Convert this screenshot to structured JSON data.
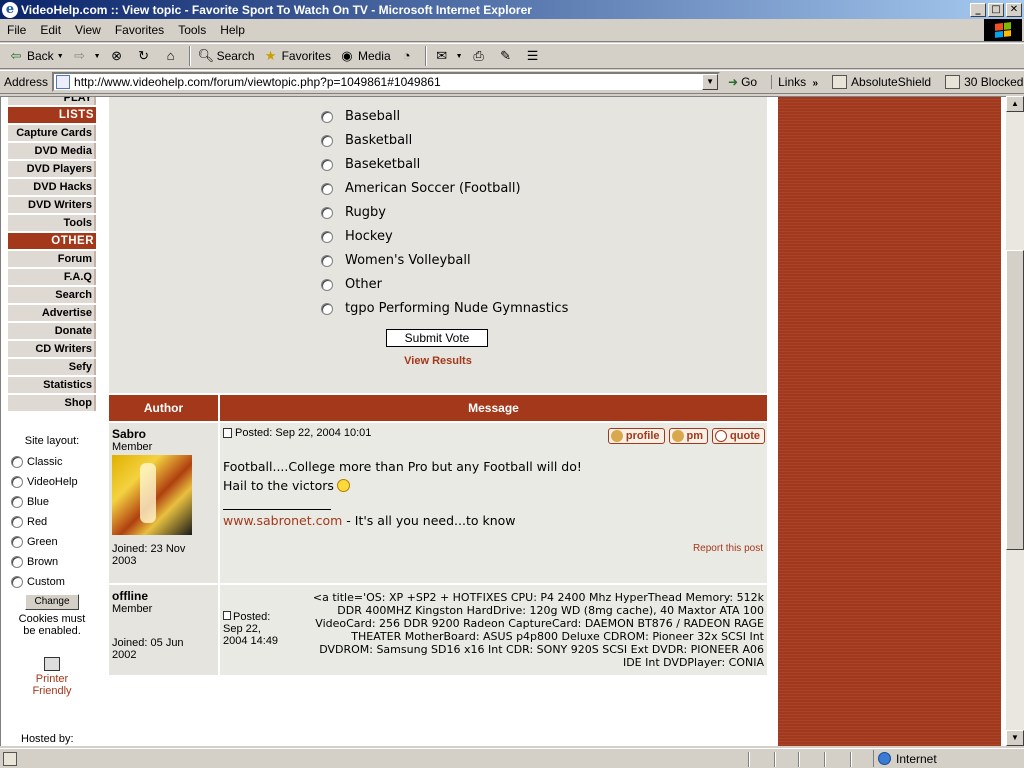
{
  "window": {
    "title": "VideoHelp.com :: View topic - Favorite Sport To Watch On TV - Microsoft Internet Explorer",
    "icon": "ie-icon",
    "buttons": [
      "_",
      "□",
      "✕"
    ]
  },
  "menu": [
    "File",
    "Edit",
    "View",
    "Favorites",
    "Tools",
    "Help"
  ],
  "toolbar": {
    "back": "Back",
    "search": "Search",
    "favorites": "Favorites",
    "media": "Media"
  },
  "address": {
    "label": "Address",
    "url": "http://www.videohelp.com/forum/viewtopic.php?p=1049861#1049861",
    "go": "Go",
    "links": "Links",
    "links_ext": "»",
    "shield": "AbsoluteShield",
    "blocked": "30 Blocked"
  },
  "nav": {
    "first": "PLAY",
    "lists_head": "LISTS",
    "lists": [
      "Capture Cards",
      "DVD Media",
      "DVD Players",
      "DVD Hacks",
      "DVD Writers",
      "Tools"
    ],
    "other_head": "OTHER",
    "other": [
      "Forum",
      "F.A.Q",
      "Search",
      "Advertise",
      "Donate",
      "CD Writers",
      "Sefy",
      "Statistics",
      "Shop"
    ]
  },
  "layout_switch": {
    "label": "Site layout:",
    "options": [
      "Classic",
      "VideoHelp",
      "Blue",
      "Red",
      "Green",
      "Brown",
      "Custom"
    ],
    "change_button": "Change",
    "cookies_line1": "Cookies must",
    "cookies_line2": "be enabled."
  },
  "printer": {
    "line1": "Printer",
    "line2": "Friendly"
  },
  "hosted_by": "Hosted by:",
  "poll": {
    "options": [
      "Baseball",
      "Basketball",
      "Baseketball",
      "American Soccer (Football)",
      "Rugby",
      "Hockey",
      "Women's Volleyball",
      "Other",
      "tgpo Performing Nude Gymnastics"
    ],
    "submit": "Submit Vote",
    "view_results": "View Results"
  },
  "table": {
    "author": "Author",
    "message": "Message"
  },
  "posts": [
    {
      "username": "Sabro",
      "rank": "Member",
      "joined_line1": "Joined: 23 Nov",
      "joined_line2": "2003",
      "posted": "Posted: Sep 22, 2004 10:01",
      "buttons": [
        "profile",
        "pm",
        "quote"
      ],
      "line1": "Football....College more than Pro but any Football will do!",
      "line2": "Hail to the victors",
      "sig_link": "www.sabronet.com",
      "sig_rest": " - It's all you need...to know",
      "report": "Report this post"
    },
    {
      "username": "offline",
      "rank": "Member",
      "joined_line1": "Joined: 05 Jun",
      "joined_line2": "2002",
      "posted_line1": "Posted:",
      "posted_line2": "Sep 22,",
      "posted_line3": "2004 14:49",
      "raw": "<a title='OS: XP +SP2 + HOTFIXES CPU: P4 2400 Mhz HyperThead Memory: 512k DDR 400MHZ Kingston HardDrive: 120g WD (8mg cache), 40 Maxtor ATA 100 VideoCard: 256 DDR 9200 Radeon CaptureCard: DAEMON BT876 / RADEON RAGE THEATER MotherBoard: ASUS p4p800 Deluxe CDROM: Pioneer 32x SCSI Int DVDROM: Samsung SD16 x16 Int CDR: SONY 920S SCSI Ext DVDR: PIONEER A06 IDE Int DVDPlayer: CONIA"
    }
  ],
  "status": {
    "zone": "Internet"
  },
  "colors": {
    "accent": "#a3381a",
    "nav_bg": "#dfd9d3",
    "poll_bg": "#e5e4df"
  }
}
